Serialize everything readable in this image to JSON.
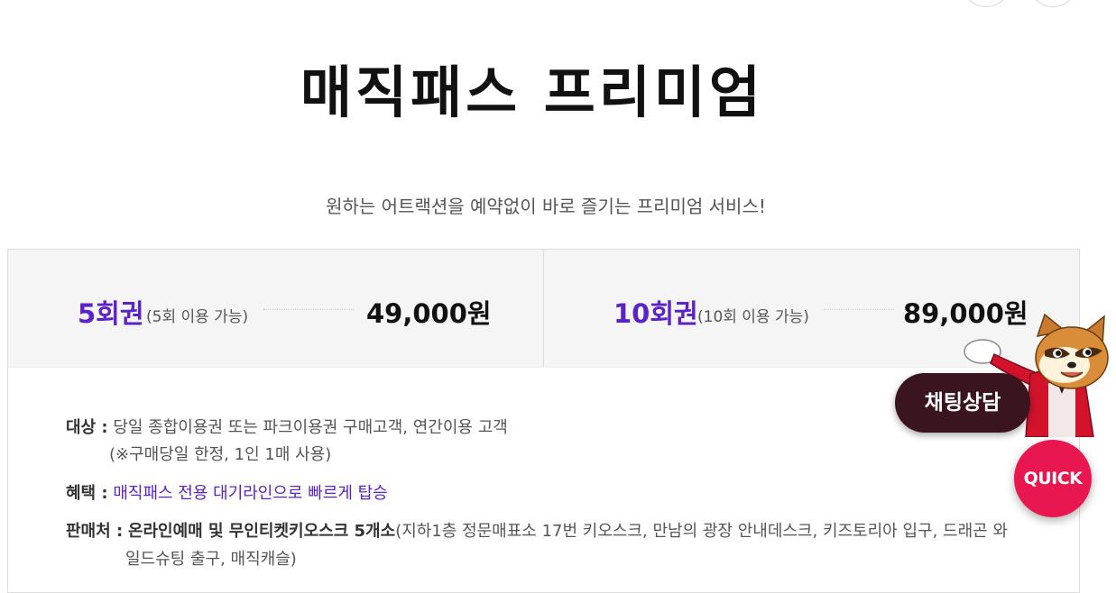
{
  "header": {
    "title": "매직패스 프리미엄",
    "subtitle": "원하는 어트랙션을 예약없이 바로 즐기는 프리미엄 서비스!"
  },
  "tickets": [
    {
      "name": "5회권",
      "note": "(5회 이용 가능)",
      "price": "49,000원"
    },
    {
      "name": "10회권",
      "note": "(10회 이용 가능)",
      "price": "89,000원"
    }
  ],
  "info": {
    "target_label": "대상 :",
    "target_text": "당일 종합이용권 또는 파크이용권 구매고객, 연간이용 고객",
    "target_note": "(※구매당일 한정, 1인 1매 사용)",
    "benefit_label": "혜택 :",
    "benefit_text": "매직패스 전용 대기라인으로 빠르게 탑승",
    "seller_label": "판매처 :",
    "seller_strong": "온라인예매 및 무인티켓키오스크 5개소",
    "seller_text_1": "(지하1층 정문매표소 17번 키오스크, 만남의 광장 안내데스크, 키즈토리아 입구, 드래곤 와",
    "seller_text_2": "일드슈팅 출구, 매직캐슬)"
  },
  "floating": {
    "chat_label": "채팅상담",
    "quick_label": "QUICK"
  },
  "colors": {
    "accent_purple": "#5a22c7",
    "quick_red": "#e8174f",
    "chat_dark": "#3a1520"
  }
}
